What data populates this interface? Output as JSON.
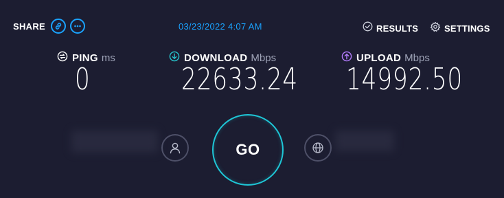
{
  "header": {
    "share_label": "SHARE",
    "timestamp": "03/23/2022 4:07 AM",
    "results_label": "RESULTS",
    "settings_label": "SETTINGS"
  },
  "metrics": {
    "ping": {
      "title": "PING",
      "unit": "ms",
      "value": "0"
    },
    "download": {
      "title": "DOWNLOAD",
      "unit": "Mbps",
      "value": "22633.24"
    },
    "upload": {
      "title": "UPLOAD",
      "unit": "Mbps",
      "value": "14992.50"
    }
  },
  "go_label": "GO",
  "colors": {
    "background": "#1c1d31",
    "accent_blue": "#1aa3ff",
    "download_teal": "#27c7cf",
    "upload_purple": "#b47cff",
    "go_ring": "#1ec6d6"
  },
  "icons": {
    "link": "link-icon",
    "more": "more-icon",
    "results": "check-circle-icon",
    "settings": "gear-icon",
    "ping": "ping-icon",
    "download": "download-arrow-icon",
    "upload": "upload-arrow-icon",
    "user": "user-icon",
    "globe": "globe-icon"
  }
}
